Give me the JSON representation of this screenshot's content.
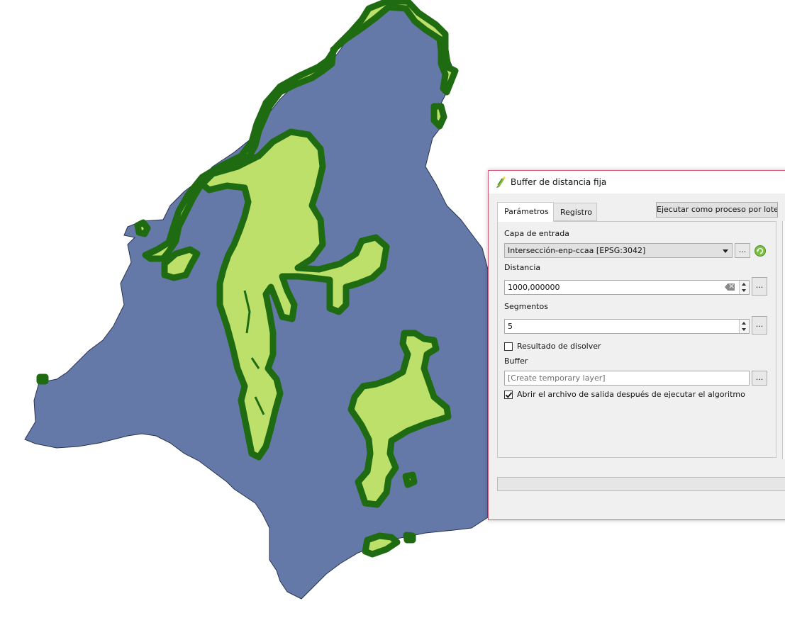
{
  "colors": {
    "region_fill": "#6579a9",
    "region_outline": "#27324e",
    "buffer_fill": "#bce06a",
    "buffer_outline": "#1f6b12",
    "dialog_border": "#d9577a"
  },
  "dialog": {
    "title": "Buffer de distancia fija",
    "icon": "buffer-tool-icon",
    "tabs": [
      {
        "label": "Parámetros",
        "active": true
      },
      {
        "label": "Registro",
        "active": false
      }
    ],
    "batch_button_label": "Ejecutar como proceso por lotes...",
    "input_layer": {
      "label": "Capa de entrada",
      "value": "Intersección-enp-ccaa [EPSG:3042]",
      "more_label": "..."
    },
    "distance": {
      "label": "Distancia",
      "value": "1000,000000",
      "more_label": "..."
    },
    "segments": {
      "label": "Segmentos",
      "value": "5",
      "more_label": "..."
    },
    "dissolve": {
      "label": "Resultado de disolver",
      "checked": false
    },
    "output": {
      "label": "Buffer",
      "placeholder": "[Create temporary layer]",
      "more_label": "..."
    },
    "open_output": {
      "label": "Abrir el archivo de salida después de ejecutar el algoritmo",
      "checked": true
    },
    "progress": 0
  }
}
